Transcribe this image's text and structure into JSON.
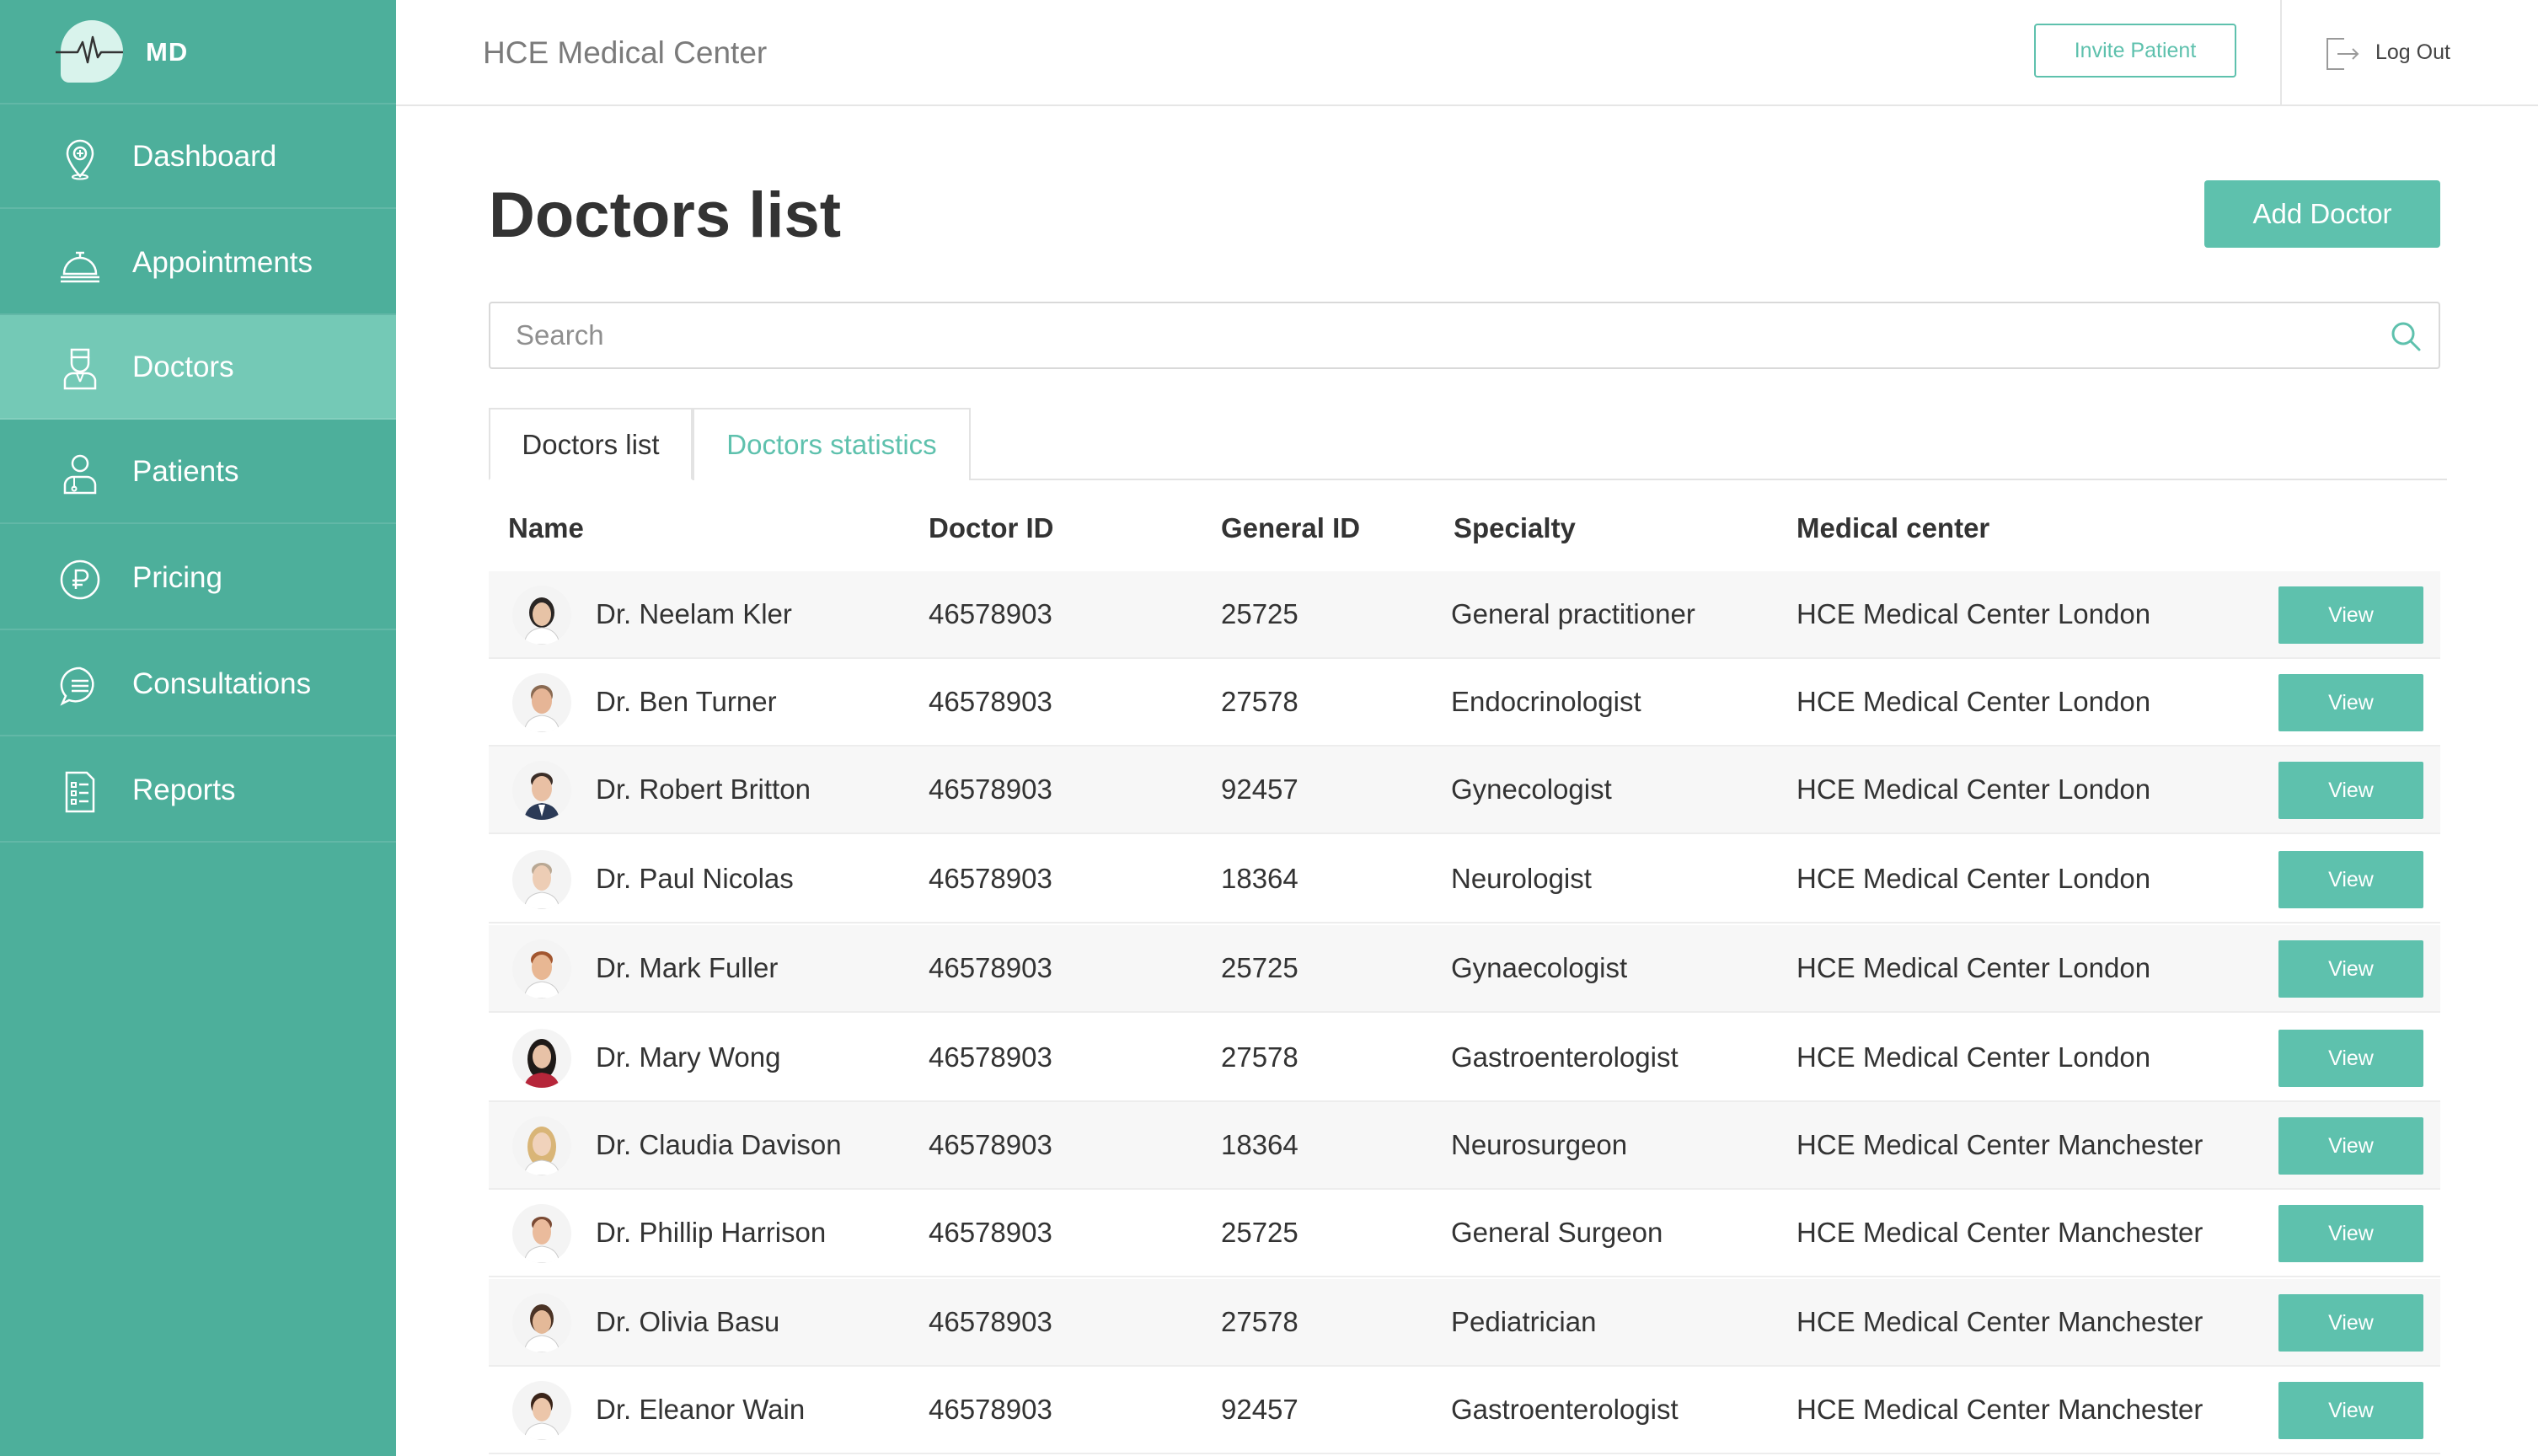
{
  "app": {
    "logo_text": "MD",
    "header_title": "HCE Medical Center",
    "invite_label": "Invite Patient",
    "logout_label": "Log Out"
  },
  "sidebar": {
    "items": [
      {
        "label": "Dashboard",
        "icon": "location-pin-icon",
        "active": false
      },
      {
        "label": "Appointments",
        "icon": "service-bell-icon",
        "active": false
      },
      {
        "label": "Doctors",
        "icon": "doctor-icon",
        "active": true
      },
      {
        "label": "Patients",
        "icon": "patient-icon",
        "active": false
      },
      {
        "label": "Pricing",
        "icon": "ruble-coin-icon",
        "active": false
      },
      {
        "label": "Consultations",
        "icon": "chat-bubble-icon",
        "active": false
      },
      {
        "label": "Reports",
        "icon": "report-document-icon",
        "active": false
      }
    ]
  },
  "main": {
    "title": "Doctors list",
    "add_label": "Add Doctor",
    "search_placeholder": "Search",
    "tabs": [
      {
        "label": "Doctors list",
        "active": true
      },
      {
        "label": "Doctors statistics",
        "active": false
      }
    ]
  },
  "table": {
    "columns": [
      "Name",
      "Doctor ID",
      "General ID",
      "Specialty",
      "Medical center"
    ],
    "view_label": "View",
    "rows": [
      {
        "name": "Dr. Neelam Kler",
        "doctor_id": "46578903",
        "general_id": "25725",
        "specialty": "General practitioner",
        "center": "HCE Medical Center London"
      },
      {
        "name": "Dr. Ben Turner",
        "doctor_id": "46578903",
        "general_id": "27578",
        "specialty": "Endocrinologist",
        "center": "HCE Medical Center London"
      },
      {
        "name": "Dr. Robert Britton",
        "doctor_id": "46578903",
        "general_id": "92457",
        "specialty": "Gynecologist",
        "center": "HCE Medical Center London"
      },
      {
        "name": "Dr. Paul Nicolas",
        "doctor_id": "46578903",
        "general_id": "18364",
        "specialty": "Neurologist",
        "center": "HCE Medical Center London"
      },
      {
        "name": "Dr. Mark Fuller",
        "doctor_id": "46578903",
        "general_id": "25725",
        "specialty": "Gynaecologist",
        "center": "HCE Medical Center London"
      },
      {
        "name": "Dr. Mary Wong",
        "doctor_id": "46578903",
        "general_id": "27578",
        "specialty": "Gastroenterologist",
        "center": "HCE Medical Center London"
      },
      {
        "name": "Dr. Claudia Davison",
        "doctor_id": "46578903",
        "general_id": "18364",
        "specialty": "Neurosurgeon",
        "center": "HCE Medical Center Manchester"
      },
      {
        "name": "Dr. Phillip Harrison",
        "doctor_id": "46578903",
        "general_id": "25725",
        "specialty": "General Surgeon",
        "center": "HCE Medical Center Manchester"
      },
      {
        "name": "Dr. Olivia Basu",
        "doctor_id": "46578903",
        "general_id": "27578",
        "specialty": "Pediatrician",
        "center": "HCE Medical Center Manchester"
      },
      {
        "name": "Dr. Eleanor Wain",
        "doctor_id": "46578903",
        "general_id": "92457",
        "specialty": "Gastroenterologist",
        "center": "HCE Medical Center Manchester"
      }
    ]
  },
  "colors": {
    "sidebar": "#4daf9b",
    "sidebar_active": "#74c9b6",
    "accent": "#5ec1ad"
  }
}
